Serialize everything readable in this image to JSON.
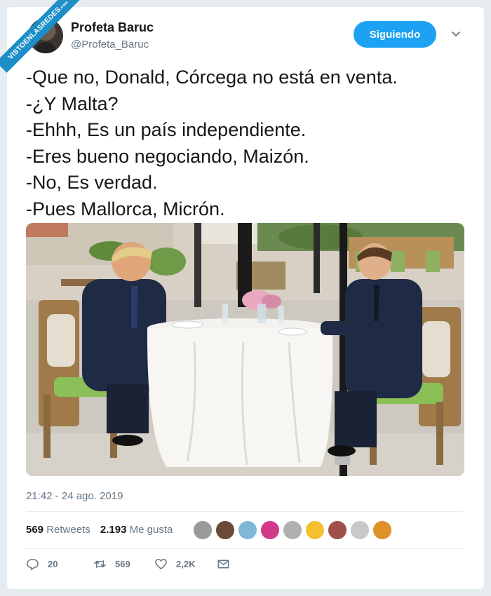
{
  "watermark": {
    "text": "VISTOENLASREDES",
    "suffix": ".com"
  },
  "author": {
    "name": "Profeta Baruc",
    "handle": "@Profeta_Baruc"
  },
  "follow_button": {
    "label": "Siguiendo"
  },
  "tweet": {
    "lines": [
      "-Que no, Donald, Córcega no está en venta.",
      "-¿Y Malta?",
      "-Ehhh, Es un país independiente.",
      "-Eres bueno negociando, Maizón.",
      "-No, Es verdad.",
      "-Pues Mallorca, Micrón."
    ]
  },
  "timestamp": "21:42 - 24 ago. 2019",
  "stats": {
    "retweets_count": "569",
    "retweets_label": "Retweets",
    "likes_count": "2.193",
    "likes_label": "Me gusta"
  },
  "liker_colors": [
    "#9a9a9a",
    "#6b4a3a",
    "#7fb7d9",
    "#d13a8a",
    "#b0b0b0",
    "#f4c030",
    "#a0504a",
    "#c8c8c8",
    "#e0902a"
  ],
  "actions": {
    "replies": "20",
    "retweets": "569",
    "likes": "2,2K"
  },
  "colors": {
    "accent": "#1da1f2",
    "ribbon": "#1c8fc8",
    "secondary_text": "#657786",
    "text": "#14171a"
  }
}
